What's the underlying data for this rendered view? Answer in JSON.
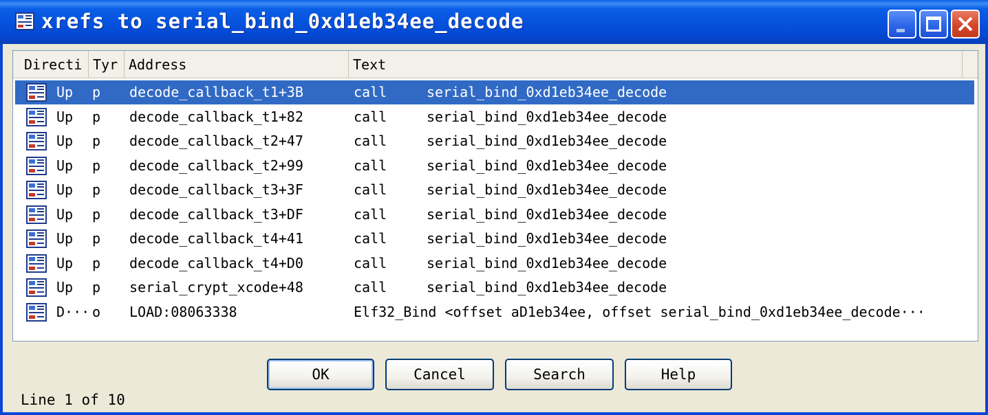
{
  "window": {
    "title": "xrefs to serial_bind_0xd1eb34ee_decode"
  },
  "columns": [
    "Directi",
    "Tyr",
    "Address",
    "Text"
  ],
  "rows": [
    {
      "dir": "Up",
      "type": "p",
      "address": "decode_callback_t1+3B",
      "inst": "call",
      "target": "serial_bind_0xd1eb34ee_decode"
    },
    {
      "dir": "Up",
      "type": "p",
      "address": "decode_callback_t1+82",
      "inst": "call",
      "target": "serial_bind_0xd1eb34ee_decode"
    },
    {
      "dir": "Up",
      "type": "p",
      "address": "decode_callback_t2+47",
      "inst": "call",
      "target": "serial_bind_0xd1eb34ee_decode"
    },
    {
      "dir": "Up",
      "type": "p",
      "address": "decode_callback_t2+99",
      "inst": "call",
      "target": "serial_bind_0xd1eb34ee_decode"
    },
    {
      "dir": "Up",
      "type": "p",
      "address": "decode_callback_t3+3F",
      "inst": "call",
      "target": "serial_bind_0xd1eb34ee_decode"
    },
    {
      "dir": "Up",
      "type": "p",
      "address": "decode_callback_t3+DF",
      "inst": "call",
      "target": "serial_bind_0xd1eb34ee_decode"
    },
    {
      "dir": "Up",
      "type": "p",
      "address": "decode_callback_t4+41",
      "inst": "call",
      "target": "serial_bind_0xd1eb34ee_decode"
    },
    {
      "dir": "Up",
      "type": "p",
      "address": "decode_callback_t4+D0",
      "inst": "call",
      "target": "serial_bind_0xd1eb34ee_decode"
    },
    {
      "dir": "Up",
      "type": "p",
      "address": "serial_crypt_xcode+48",
      "inst": "call",
      "target": "serial_bind_0xd1eb34ee_decode"
    },
    {
      "dir": "D···",
      "type": "o",
      "address": "LOAD:08063338",
      "text": "Elf32_Bind <offset aD1eb34ee, offset serial_bind_0xd1eb34ee_decode···"
    }
  ],
  "selected_row": 0,
  "buttons": {
    "ok": "OK",
    "cancel": "Cancel",
    "search": "Search",
    "help": "Help"
  },
  "status": "Line 1 of 10",
  "icons": {
    "title": "xref-window-icon",
    "row": "xref-row-icon"
  },
  "colors": {
    "titlebar": "#0551dc",
    "selection": "#316ac5",
    "close_button": "#d5462a"
  }
}
